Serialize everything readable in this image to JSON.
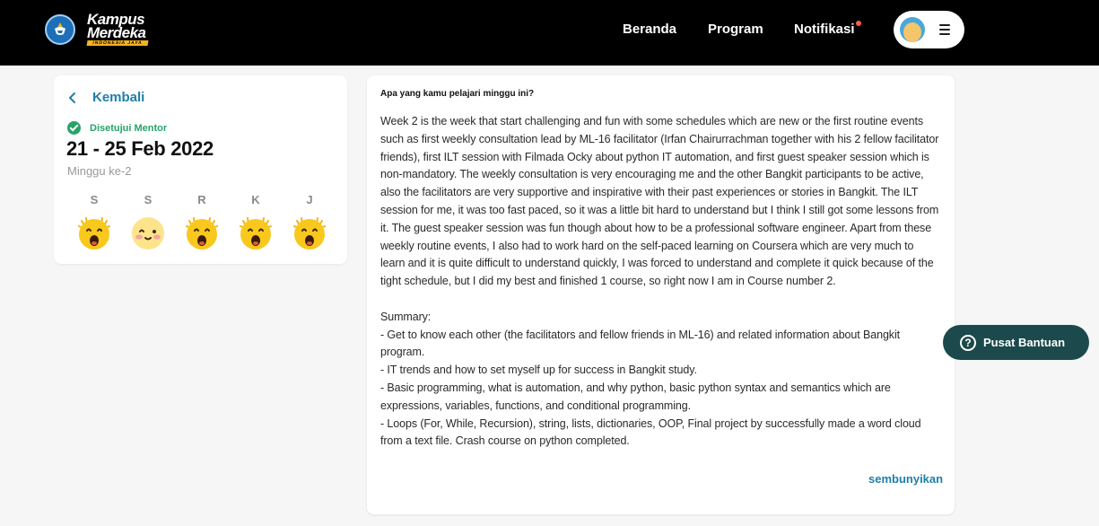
{
  "header": {
    "logo": {
      "line1": "Kampus",
      "line2": "Merdeka",
      "tagline": "INDONESIA JAYA"
    },
    "nav": [
      {
        "label": "Beranda"
      },
      {
        "label": "Program"
      },
      {
        "label": "Notifikasi",
        "has_unread": true
      }
    ],
    "profile": {
      "avatar": "user-avatar",
      "menu_icon": "hamburger-menu-icon"
    }
  },
  "sidebar": {
    "back_label": "Kembali",
    "status": {
      "label": "Disetujui Mentor",
      "icon": "check-circle-icon",
      "color": "#27a36a"
    },
    "date_range": "21 - 25 Feb 2022",
    "week_label": "Minggu ke-2",
    "days": [
      {
        "letter": "S",
        "mood": "excited-emoji"
      },
      {
        "letter": "S",
        "mood": "happy-emoji"
      },
      {
        "letter": "R",
        "mood": "excited-emoji"
      },
      {
        "letter": "K",
        "mood": "excited-emoji"
      },
      {
        "letter": "J",
        "mood": "excited-emoji"
      }
    ]
  },
  "report": {
    "question": "Apa yang kamu pelajari minggu ini?",
    "answer": "Week 2 is the week that start challenging and fun with some schedules which are new or the first routine events such as first weekly consultation lead by ML-16 facilitator (Irfan Chairurrachman together with his 2 fellow facilitator friends), first ILT session with Filmada Ocky about python IT automation, and first guest speaker session which is non-mandatory. The weekly consultation is very encouraging me and the other Bangkit participants to be active, also the facilitators are very supportive and inspirative with their past experiences or stories in Bangkit. The ILT session for me, it was too fast paced, so it was a little bit hard to understand but I think I still got some lessons from it. The guest speaker session was fun though about how to be a professional software engineer. Apart from these weekly routine events, I also had to work hard on the self-paced learning on Coursera which are very much to learn and it is quite difficult to understand quickly, I was forced to understand and complete it quick because of the tight schedule, but I did my best and finished 1 course, so right now I am in Course number 2.\n\nSummary:\n- Get to know each other (the facilitators and fellow friends in ML-16) and related information about Bangkit program.\n- IT trends and how to set myself up for success in Bangkit study.\n- Basic programming, what is automation, and why python, basic python syntax and semantics which are expressions, variables, functions, and conditional programming.\n- Loops (For, While, Recursion), string, lists, dictionaries, OOP, Final project by successfully made a word cloud from a text file. Crash course on python completed.",
    "hide_label": "sembunyikan"
  },
  "help": {
    "label": "Pusat Bantuan",
    "icon": "question-circle-icon"
  },
  "colors": {
    "header_bg": "#000000",
    "accent_blue": "#1f7fa8",
    "help_bg": "#1c4a4c",
    "emoji_yellow": "#f8c81c"
  }
}
